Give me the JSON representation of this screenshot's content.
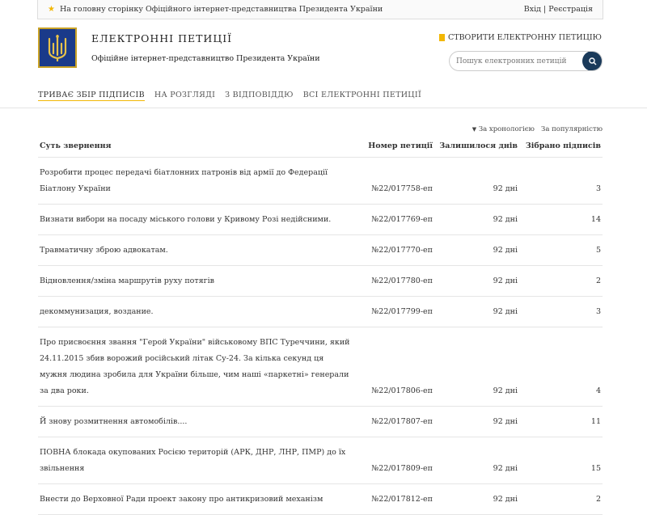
{
  "topbar": {
    "home_link": "На головну сторінку Офіційного інтернет-представництва Президента України",
    "auth": "Вхід | Реєстрація"
  },
  "header": {
    "title": "ЕЛЕКТРОННІ ПЕТИЦІЇ",
    "subtitle": "Офіційне інтернет-представництво Президента України",
    "create_link": "СТВОРИТИ ЕЛЕКТРОННУ ПЕТИЦІЮ",
    "search_placeholder": "Пошук електронних петицій"
  },
  "nav": [
    {
      "label": "ТРИВАЄ ЗБІР ПІДПИСІВ",
      "active": true
    },
    {
      "label": "НА РОЗГЛЯДІ",
      "active": false
    },
    {
      "label": "З ВІДПОВІДДЮ",
      "active": false
    },
    {
      "label": "ВСІ ЕЛЕКТРОННІ ПЕТИЦІЇ",
      "active": false
    }
  ],
  "sort": {
    "chronology": "За хронологією",
    "popularity": "За популярністю"
  },
  "table": {
    "headers": [
      "Суть звернення",
      "Номер петиції",
      "Залишилося днів",
      "Зібрано підписів"
    ],
    "rows": [
      {
        "subject": "Розробити процес передачі біатлонних патронів від армії до Федерації Біатлону України",
        "number": "№22/017758-еп",
        "days": "92 дні",
        "signatures": "3"
      },
      {
        "subject": "Визнати вибори на посаду міського голови у Кривому Розі недійсними.",
        "number": "№22/017769-еп",
        "days": "92 дні",
        "signatures": "14"
      },
      {
        "subject": "Травматичну зброю адвокатам.",
        "number": "№22/017770-еп",
        "days": "92 дні",
        "signatures": "5"
      },
      {
        "subject": "Відновлення/зміна маршрутів руху потягів",
        "number": "№22/017780-еп",
        "days": "92 дні",
        "signatures": "2"
      },
      {
        "subject": "декоммунизация, воздание.",
        "number": "№22/017799-еп",
        "days": "92 дні",
        "signatures": "3"
      },
      {
        "subject": "Про присвоєння звання \"Герой України\" військовому ВПС Туреччини, який 24.11.2015 збив ворожий російський літак Су-24. За кілька секунд ця мужня людина зробила для України більше, чим наші «паркетні» генерали за два роки.",
        "number": "№22/017806-еп",
        "days": "92 дні",
        "signatures": "4"
      },
      {
        "subject": "Й знову розмитнення автомобілів....",
        "number": "№22/017807-еп",
        "days": "92 дні",
        "signatures": "11"
      },
      {
        "subject": "ПОВНА блокада окупованих Росією територій (АРК, ДНР, ЛНР, ПМР) до їх звільнення",
        "number": "№22/017809-еп",
        "days": "92 дні",
        "signatures": "15"
      },
      {
        "subject": "Внести до Верховної Ради проект закону про антикризовий механізм",
        "number": "№22/017812-еп",
        "days": "92 дні",
        "signatures": "2"
      }
    ]
  }
}
